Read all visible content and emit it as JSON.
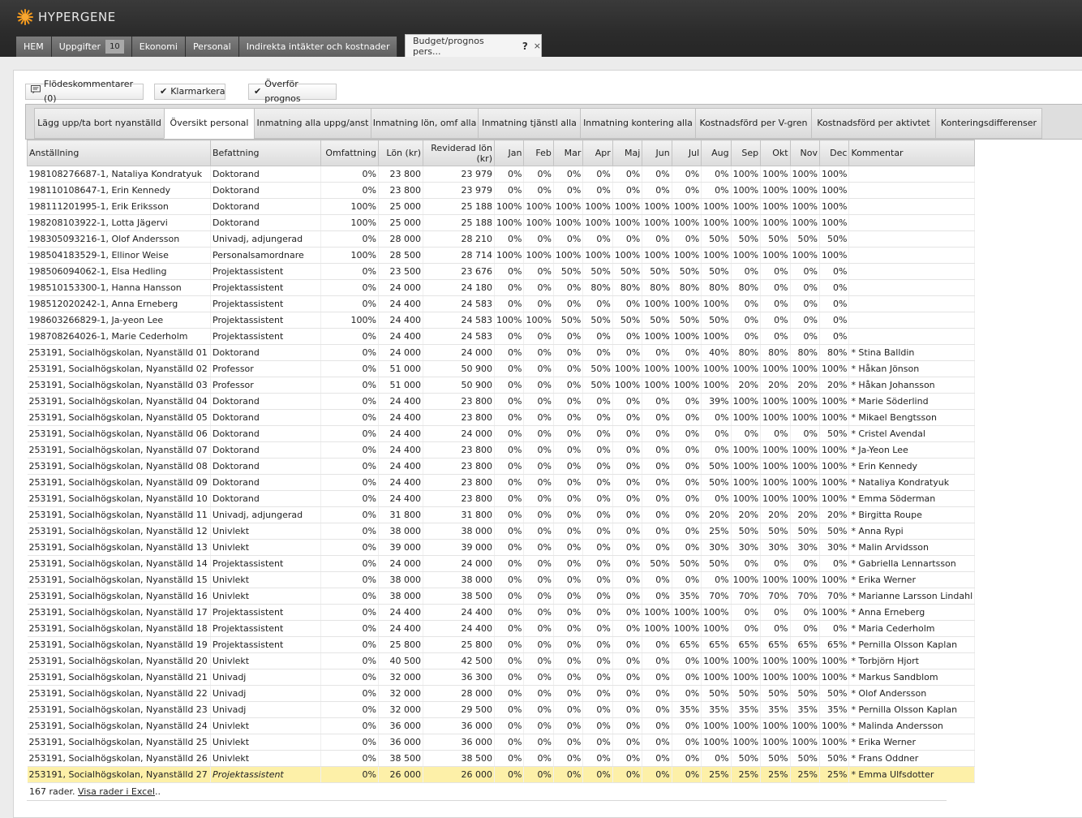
{
  "app": {
    "brand": "HYPERGENE",
    "brand_color": "#f39a1e"
  },
  "nav": {
    "tabs": [
      {
        "label": "HEM"
      },
      {
        "label": "Uppgifter",
        "badge": "10"
      },
      {
        "label": "Ekonomi"
      },
      {
        "label": "Personal"
      },
      {
        "label": "Indirekta intäkter och kostnader"
      }
    ],
    "active_tab": {
      "label": "Budget/prognos pers...",
      "help": "?",
      "close": "×"
    }
  },
  "toolbar": {
    "comments_label": "Flödeskommentarer (0)",
    "mark_done_label": "Klarmarkera",
    "transfer_label": "Överför prognos"
  },
  "subtabs": [
    "Lägg upp/ta bort nyanställd",
    "Översikt personal",
    "Inmatning alla uppg/anst",
    "Inmatning lön, omf alla",
    "Inmatning tjänstl alla",
    "Inmatning kontering alla",
    "Kostnadsförd per V-gren",
    "Kostnadsförd per aktivtet",
    "Konteringsdifferenser"
  ],
  "active_subtab_index": 1,
  "table": {
    "columns": [
      "Anställning",
      "Befattning",
      "Omfattning",
      "Lön (kr)",
      "Reviderad lön (kr)",
      "Jan",
      "Feb",
      "Mar",
      "Apr",
      "Maj",
      "Jun",
      "Jul",
      "Aug",
      "Sep",
      "Okt",
      "Nov",
      "Dec",
      "Kommentar"
    ],
    "rows": [
      [
        "198108276687-1, Nataliya Kondratyuk",
        "Doktorand",
        "0%",
        "23 800",
        "23 979",
        "0%",
        "0%",
        "0%",
        "0%",
        "0%",
        "0%",
        "0%",
        "0%",
        "100%",
        "100%",
        "100%",
        "100%",
        ""
      ],
      [
        "198110108647-1, Erin Kennedy",
        "Doktorand",
        "0%",
        "23 800",
        "23 979",
        "0%",
        "0%",
        "0%",
        "0%",
        "0%",
        "0%",
        "0%",
        "0%",
        "100%",
        "100%",
        "100%",
        "100%",
        ""
      ],
      [
        "198111201995-1, Erik Eriksson",
        "Doktorand",
        "100%",
        "25 000",
        "25 188",
        "100%",
        "100%",
        "100%",
        "100%",
        "100%",
        "100%",
        "100%",
        "100%",
        "100%",
        "100%",
        "100%",
        "100%",
        ""
      ],
      [
        "198208103922-1, Lotta Jägervi",
        "Doktorand",
        "100%",
        "25 000",
        "25 188",
        "100%",
        "100%",
        "100%",
        "100%",
        "100%",
        "100%",
        "100%",
        "100%",
        "100%",
        "100%",
        "100%",
        "100%",
        ""
      ],
      [
        "198305093216-1, Olof Andersson",
        "Univadj, adjungerad",
        "0%",
        "28 000",
        "28 210",
        "0%",
        "0%",
        "0%",
        "0%",
        "0%",
        "0%",
        "0%",
        "50%",
        "50%",
        "50%",
        "50%",
        "50%",
        ""
      ],
      [
        "198504183529-1, Ellinor Weise",
        "Personalsamordnare",
        "100%",
        "28 500",
        "28 714",
        "100%",
        "100%",
        "100%",
        "100%",
        "100%",
        "100%",
        "100%",
        "100%",
        "100%",
        "100%",
        "100%",
        "100%",
        ""
      ],
      [
        "198506094062-1, Elsa Hedling",
        "Projektassistent",
        "0%",
        "23 500",
        "23 676",
        "0%",
        "0%",
        "50%",
        "50%",
        "50%",
        "50%",
        "50%",
        "50%",
        "0%",
        "0%",
        "0%",
        "0%",
        ""
      ],
      [
        "198510153300-1, Hanna Hansson",
        "Projektassistent",
        "0%",
        "24 000",
        "24 180",
        "0%",
        "0%",
        "0%",
        "80%",
        "80%",
        "80%",
        "80%",
        "80%",
        "80%",
        "0%",
        "0%",
        "0%",
        ""
      ],
      [
        "198512020242-1, Anna Erneberg",
        "Projektassistent",
        "0%",
        "24 400",
        "24 583",
        "0%",
        "0%",
        "0%",
        "0%",
        "0%",
        "100%",
        "100%",
        "100%",
        "0%",
        "0%",
        "0%",
        "0%",
        ""
      ],
      [
        "198603266829-1, Ja-yeon Lee",
        "Projektassistent",
        "100%",
        "24 400",
        "24 583",
        "100%",
        "100%",
        "50%",
        "50%",
        "50%",
        "50%",
        "50%",
        "50%",
        "0%",
        "0%",
        "0%",
        "0%",
        ""
      ],
      [
        "198708264026-1, Marie Cederholm",
        "Projektassistent",
        "0%",
        "24 400",
        "24 583",
        "0%",
        "0%",
        "0%",
        "0%",
        "0%",
        "100%",
        "100%",
        "100%",
        "0%",
        "0%",
        "0%",
        "0%",
        ""
      ],
      [
        "253191, Socialhögskolan, Nyanställd 01",
        "Doktorand",
        "0%",
        "24 000",
        "24 000",
        "0%",
        "0%",
        "0%",
        "0%",
        "0%",
        "0%",
        "0%",
        "40%",
        "80%",
        "80%",
        "80%",
        "80%",
        "* Stina Balldin"
      ],
      [
        "253191, Socialhögskolan, Nyanställd 02",
        "Professor",
        "0%",
        "51 000",
        "50 900",
        "0%",
        "0%",
        "0%",
        "50%",
        "100%",
        "100%",
        "100%",
        "100%",
        "100%",
        "100%",
        "100%",
        "100%",
        "* Håkan Jönson"
      ],
      [
        "253191, Socialhögskolan, Nyanställd 03",
        "Professor",
        "0%",
        "51 000",
        "50 900",
        "0%",
        "0%",
        "0%",
        "50%",
        "100%",
        "100%",
        "100%",
        "100%",
        "20%",
        "20%",
        "20%",
        "20%",
        "* Håkan Johansson"
      ],
      [
        "253191, Socialhögskolan, Nyanställd 04",
        "Doktorand",
        "0%",
        "24 400",
        "23 800",
        "0%",
        "0%",
        "0%",
        "0%",
        "0%",
        "0%",
        "0%",
        "39%",
        "100%",
        "100%",
        "100%",
        "100%",
        "* Marie Söderlind"
      ],
      [
        "253191, Socialhögskolan, Nyanställd 05",
        "Doktorand",
        "0%",
        "24 400",
        "23 800",
        "0%",
        "0%",
        "0%",
        "0%",
        "0%",
        "0%",
        "0%",
        "0%",
        "100%",
        "100%",
        "100%",
        "100%",
        "* Mikael Bengtsson"
      ],
      [
        "253191, Socialhögskolan, Nyanställd 06",
        "Doktorand",
        "0%",
        "24 400",
        "24 000",
        "0%",
        "0%",
        "0%",
        "0%",
        "0%",
        "0%",
        "0%",
        "0%",
        "0%",
        "0%",
        "0%",
        "50%",
        "* Cristel Avendal"
      ],
      [
        "253191, Socialhögskolan, Nyanställd 07",
        "Doktorand",
        "0%",
        "24 400",
        "23 800",
        "0%",
        "0%",
        "0%",
        "0%",
        "0%",
        "0%",
        "0%",
        "0%",
        "100%",
        "100%",
        "100%",
        "100%",
        "* Ja-Yeon Lee"
      ],
      [
        "253191, Socialhögskolan, Nyanställd 08",
        "Doktorand",
        "0%",
        "24 400",
        "23 800",
        "0%",
        "0%",
        "0%",
        "0%",
        "0%",
        "0%",
        "0%",
        "50%",
        "100%",
        "100%",
        "100%",
        "100%",
        "* Erin Kennedy"
      ],
      [
        "253191, Socialhögskolan, Nyanställd 09",
        "Doktorand",
        "0%",
        "24 400",
        "23 800",
        "0%",
        "0%",
        "0%",
        "0%",
        "0%",
        "0%",
        "0%",
        "50%",
        "100%",
        "100%",
        "100%",
        "100%",
        "* Nataliya Kondratyuk"
      ],
      [
        "253191, Socialhögskolan, Nyanställd 10",
        "Doktorand",
        "0%",
        "24 400",
        "23 800",
        "0%",
        "0%",
        "0%",
        "0%",
        "0%",
        "0%",
        "0%",
        "0%",
        "100%",
        "100%",
        "100%",
        "100%",
        "* Emma Söderman"
      ],
      [
        "253191, Socialhögskolan, Nyanställd 11",
        "Univadj, adjungerad",
        "0%",
        "31 800",
        "31 800",
        "0%",
        "0%",
        "0%",
        "0%",
        "0%",
        "0%",
        "0%",
        "20%",
        "20%",
        "20%",
        "20%",
        "20%",
        "* Birgitta Roupe"
      ],
      [
        "253191, Socialhögskolan, Nyanställd 12",
        "Univlekt",
        "0%",
        "38 000",
        "38 000",
        "0%",
        "0%",
        "0%",
        "0%",
        "0%",
        "0%",
        "0%",
        "25%",
        "50%",
        "50%",
        "50%",
        "50%",
        "* Anna Rypi"
      ],
      [
        "253191, Socialhögskolan, Nyanställd 13",
        "Univlekt",
        "0%",
        "39 000",
        "39 000",
        "0%",
        "0%",
        "0%",
        "0%",
        "0%",
        "0%",
        "0%",
        "30%",
        "30%",
        "30%",
        "30%",
        "30%",
        "* Malin Arvidsson"
      ],
      [
        "253191, Socialhögskolan, Nyanställd 14",
        "Projektassistent",
        "0%",
        "24 000",
        "24 000",
        "0%",
        "0%",
        "0%",
        "0%",
        "0%",
        "50%",
        "50%",
        "50%",
        "0%",
        "0%",
        "0%",
        "0%",
        "* Gabriella Lennartsson"
      ],
      [
        "253191, Socialhögskolan, Nyanställd 15",
        "Univlekt",
        "0%",
        "38 000",
        "38 000",
        "0%",
        "0%",
        "0%",
        "0%",
        "0%",
        "0%",
        "0%",
        "0%",
        "100%",
        "100%",
        "100%",
        "100%",
        "* Erika Werner"
      ],
      [
        "253191, Socialhögskolan, Nyanställd 16",
        "Univlekt",
        "0%",
        "38 000",
        "38 500",
        "0%",
        "0%",
        "0%",
        "0%",
        "0%",
        "0%",
        "35%",
        "70%",
        "70%",
        "70%",
        "70%",
        "70%",
        "* Marianne Larsson Lindahl"
      ],
      [
        "253191, Socialhögskolan, Nyanställd 17",
        "Projektassistent",
        "0%",
        "24 400",
        "24 400",
        "0%",
        "0%",
        "0%",
        "0%",
        "0%",
        "100%",
        "100%",
        "100%",
        "0%",
        "0%",
        "0%",
        "100%",
        "* Anna Erneberg"
      ],
      [
        "253191, Socialhögskolan, Nyanställd 18",
        "Projektassistent",
        "0%",
        "24 400",
        "24 400",
        "0%",
        "0%",
        "0%",
        "0%",
        "0%",
        "100%",
        "100%",
        "100%",
        "0%",
        "0%",
        "0%",
        "0%",
        "* Maria Cederholm"
      ],
      [
        "253191, Socialhögskolan, Nyanställd 19",
        "Projektassistent",
        "0%",
        "25 800",
        "25 800",
        "0%",
        "0%",
        "0%",
        "0%",
        "0%",
        "0%",
        "65%",
        "65%",
        "65%",
        "65%",
        "65%",
        "65%",
        "* Pernilla Olsson Kaplan"
      ],
      [
        "253191, Socialhögskolan, Nyanställd 20",
        "Univlekt",
        "0%",
        "40 500",
        "42 500",
        "0%",
        "0%",
        "0%",
        "0%",
        "0%",
        "0%",
        "0%",
        "100%",
        "100%",
        "100%",
        "100%",
        "100%",
        "* Torbjörn Hjort"
      ],
      [
        "253191, Socialhögskolan, Nyanställd 21",
        "Univadj",
        "0%",
        "32 000",
        "36 300",
        "0%",
        "0%",
        "0%",
        "0%",
        "0%",
        "0%",
        "0%",
        "100%",
        "100%",
        "100%",
        "100%",
        "100%",
        "* Markus Sandblom"
      ],
      [
        "253191, Socialhögskolan, Nyanställd 22",
        "Univadj",
        "0%",
        "32 000",
        "28 000",
        "0%",
        "0%",
        "0%",
        "0%",
        "0%",
        "0%",
        "0%",
        "50%",
        "50%",
        "50%",
        "50%",
        "50%",
        "* Olof Andersson"
      ],
      [
        "253191, Socialhögskolan, Nyanställd 23",
        "Univadj",
        "0%",
        "32 000",
        "29 500",
        "0%",
        "0%",
        "0%",
        "0%",
        "0%",
        "0%",
        "35%",
        "35%",
        "35%",
        "35%",
        "35%",
        "35%",
        "* Pernilla Olsson Kaplan"
      ],
      [
        "253191, Socialhögskolan, Nyanställd 24",
        "Univlekt",
        "0%",
        "36 000",
        "36 000",
        "0%",
        "0%",
        "0%",
        "0%",
        "0%",
        "0%",
        "0%",
        "100%",
        "100%",
        "100%",
        "100%",
        "100%",
        "* Malinda Andersson"
      ],
      [
        "253191, Socialhögskolan, Nyanställd 25",
        "Univlekt",
        "0%",
        "36 000",
        "36 000",
        "0%",
        "0%",
        "0%",
        "0%",
        "0%",
        "0%",
        "0%",
        "100%",
        "100%",
        "100%",
        "100%",
        "100%",
        "* Erika Werner"
      ],
      [
        "253191, Socialhögskolan, Nyanställd 26",
        "Univlekt",
        "0%",
        "38 500",
        "38 500",
        "0%",
        "0%",
        "0%",
        "0%",
        "0%",
        "0%",
        "0%",
        "0%",
        "50%",
        "50%",
        "50%",
        "50%",
        "* Frans Oddner"
      ],
      [
        "253191, Socialhögskolan, Nyanställd 27",
        "Projektassistent",
        "0%",
        "26 000",
        "26 000",
        "0%",
        "0%",
        "0%",
        "0%",
        "0%",
        "0%",
        "0%",
        "25%",
        "25%",
        "25%",
        "25%",
        "25%",
        "* Emma Ulfsdotter"
      ]
    ],
    "selected_row_index": 37,
    "selected_color": "#fdf0a8"
  },
  "footer": {
    "count_text": "167 rader.",
    "excel_link": "Visa rader i Excel",
    "suffix": ".."
  }
}
